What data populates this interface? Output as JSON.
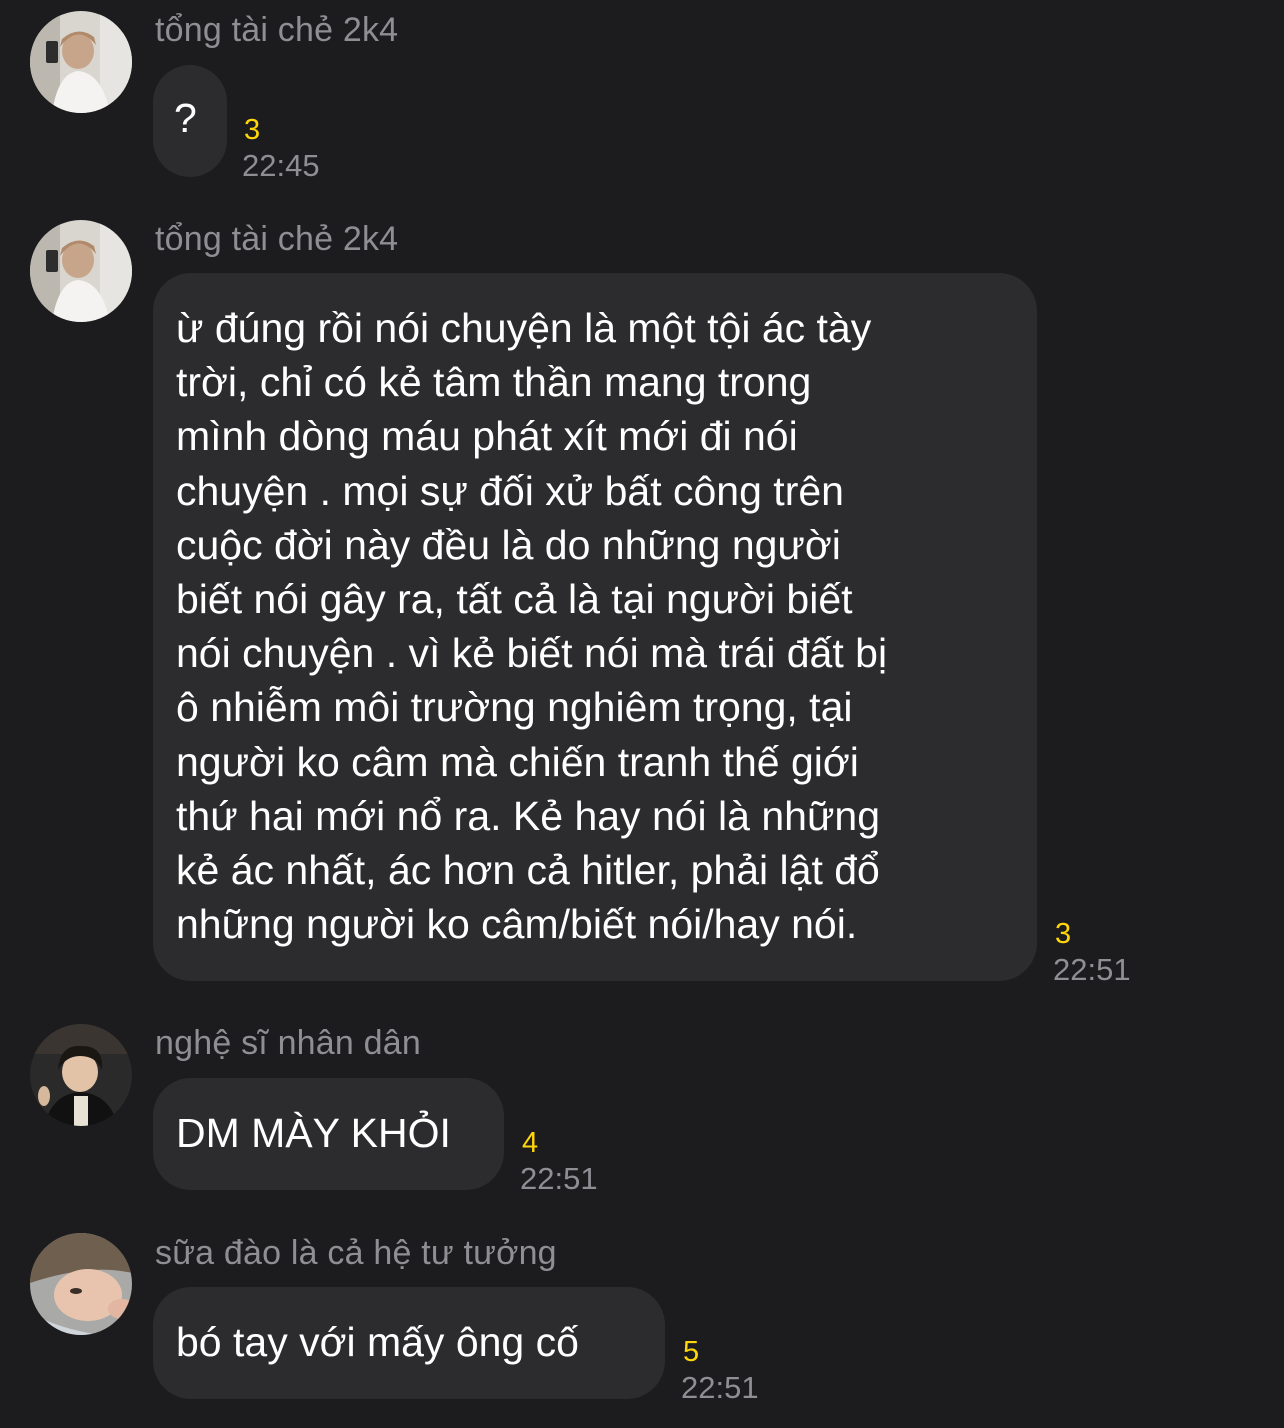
{
  "colors": {
    "background": "#1c1c1e",
    "bubble": "#2c2c2e",
    "sender_name": "#8e8e93",
    "timestamp": "#8e8e93",
    "reaction_count": "#ffd60a"
  },
  "messages": [
    {
      "sender": "tổng tài chẻ 2k4",
      "avatar_icon": "user-avatar-icon",
      "text": "?",
      "count": "3",
      "time": "22:45"
    },
    {
      "sender": "tổng tài chẻ 2k4",
      "avatar_icon": "user-avatar-icon",
      "text": "ừ đúng rồi nói chuyện  là một tội ác tày\ntrời, chỉ có kẻ tâm thần mang trong\nmình dòng máu phát xít mới đi nói\nchuyện . mọi sự đối xử bất công trên\ncuộc đời này đều là do những người\nbiết nói gây ra, tất cả là tại người biết\nnói chuyện . vì kẻ biết nói mà trái đất bị\nô nhiễm môi trường nghiêm trọng, tại\nngười ko câm mà chiến tranh thế giới\nthứ hai mới nổ ra. Kẻ hay nói là những\nkẻ ác nhất, ác hơn cả hitler, phải lật đổ\nnhững người ko câm/biết nói/hay nói.",
      "count": "3",
      "time": "22:51"
    },
    {
      "sender": "nghệ sĩ nhân dân",
      "avatar_icon": "user-avatar-icon",
      "text": "DM MÀY KHỎI",
      "count": "4",
      "time": "22:51"
    },
    {
      "sender": "sữa đào là cả hệ tư tưởng",
      "avatar_icon": "user-avatar-icon",
      "text": "bó tay với mấy ông cố",
      "count": "5",
      "time": "22:51"
    }
  ]
}
